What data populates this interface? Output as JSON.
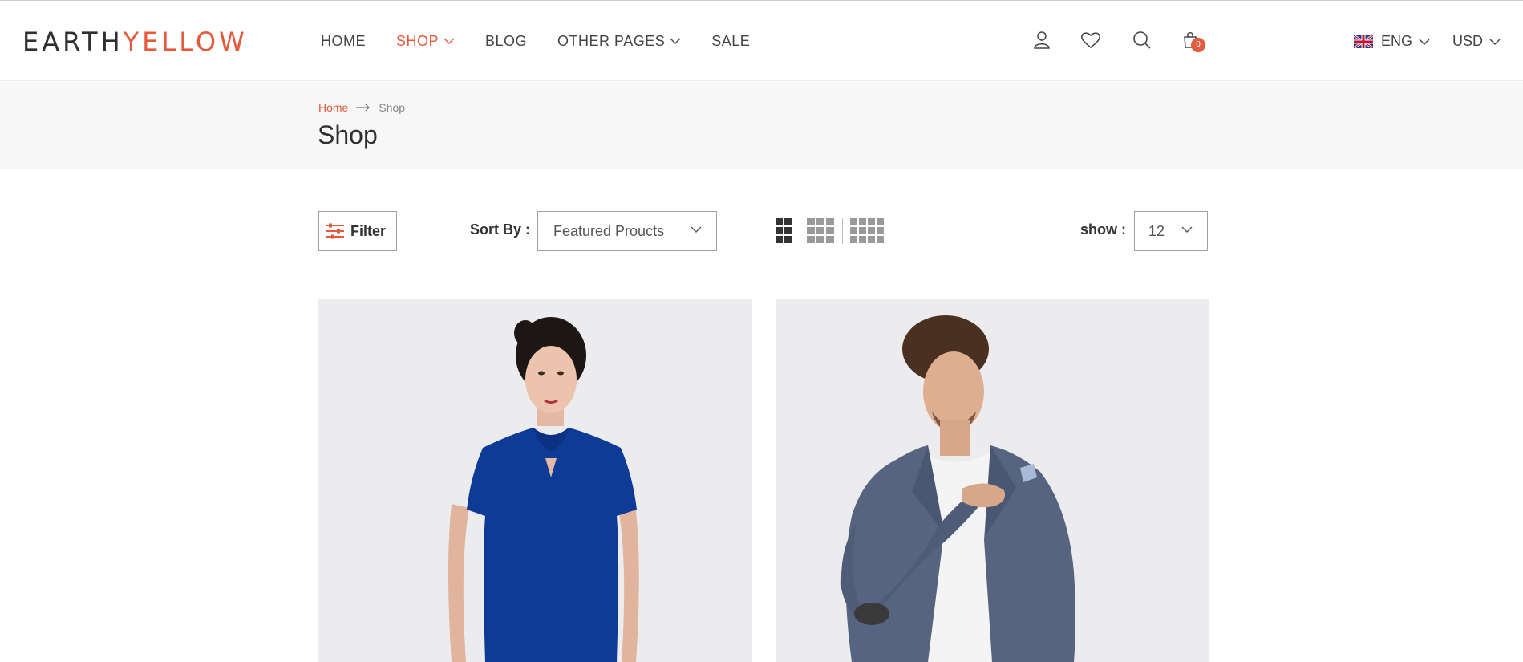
{
  "header": {
    "logo": {
      "part1": "EARTH",
      "part2": "YELLOW"
    },
    "nav": [
      {
        "label": "HOME",
        "active": false,
        "dropdown": false
      },
      {
        "label": "SHOP",
        "active": true,
        "dropdown": true
      },
      {
        "label": "BLOG",
        "active": false,
        "dropdown": false
      },
      {
        "label": "OTHER PAGES",
        "active": false,
        "dropdown": true
      },
      {
        "label": "SALE",
        "active": false,
        "dropdown": false
      }
    ],
    "icons": [
      "user-icon",
      "heart-icon",
      "search-icon",
      "shopping-bag-icon"
    ],
    "cart_count": "0",
    "language": "ENG",
    "currency": "USD"
  },
  "breadcrumb": {
    "home": "Home",
    "current": "Shop"
  },
  "page_title": "Shop",
  "toolbar": {
    "filter_label": "Filter",
    "sort_label": "Sort By :",
    "sort_value": "Featured Proucts",
    "show_label": "show :",
    "show_value": "12",
    "grid_views": [
      "grid-2-icon",
      "grid-3-icon",
      "grid-4-icon"
    ]
  },
  "products": [
    {
      "image": "woman-in-blue-dress"
    },
    {
      "image": "man-in-grey-blazer"
    }
  ],
  "colors": {
    "accent": "#e55a3c",
    "text": "#333333",
    "crumb_bg": "#f7f7f7",
    "card_bg": "#ececee"
  }
}
